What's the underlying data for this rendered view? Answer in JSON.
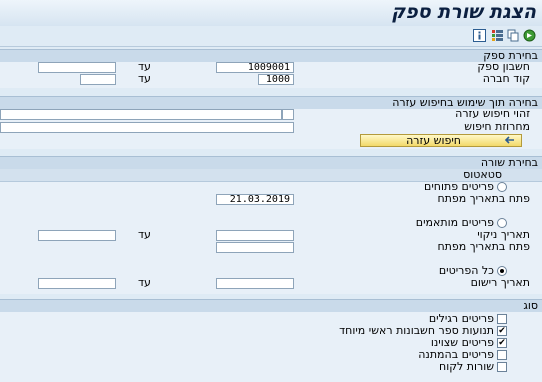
{
  "window": {
    "title": "הצגת שורת ספק"
  },
  "vendor_selection": {
    "header": "בחירת ספק",
    "vendor_account_label": "חשבון ספק",
    "vendor_account_value": "1009001",
    "company_code_label": "קוד חברה",
    "company_code_value": "1000",
    "to_label": "עד"
  },
  "search_help": {
    "header": "בחירה תוך שימוש בחיפוש עזרה",
    "search_id_label": "זהוי חיפוש עזרה",
    "search_string_label": "מחרוזת חיפוש",
    "button_label": "חיפוש עזרה"
  },
  "line_selection": {
    "header": "בחירת שורה",
    "status_header": "סטאטוס",
    "open_items_label": "פריטים פתוחים",
    "open_at_key_date_label": "פתח בתאריך מפתח",
    "open_at_key_date_value": "21.03.2019",
    "cleared_items_label": "פריטים מותאמים",
    "clearing_date_label": "תאריך ניקוי",
    "open_at_key_date2_label": "פתח בתאריך מפתח",
    "all_items_label": "כל הפריטים",
    "posting_date_label": "תאריך רישום",
    "to_label": "עד",
    "selected_radio": "all_items"
  },
  "type": {
    "header": "סוג",
    "items": [
      {
        "label": "פריטים רגילים",
        "checked": false
      },
      {
        "label": "תנועות ספר חשבונות ראשי מיוחד",
        "checked": true
      },
      {
        "label": "פריטים שצוינו",
        "checked": true
      },
      {
        "label": "פריטים בהמתנה",
        "checked": false
      },
      {
        "label": "שורות לקוח",
        "checked": false
      }
    ]
  },
  "toolbar": {
    "icons": [
      "execute-icon",
      "copy-icon",
      "variant-icon",
      "info-icon"
    ]
  }
}
